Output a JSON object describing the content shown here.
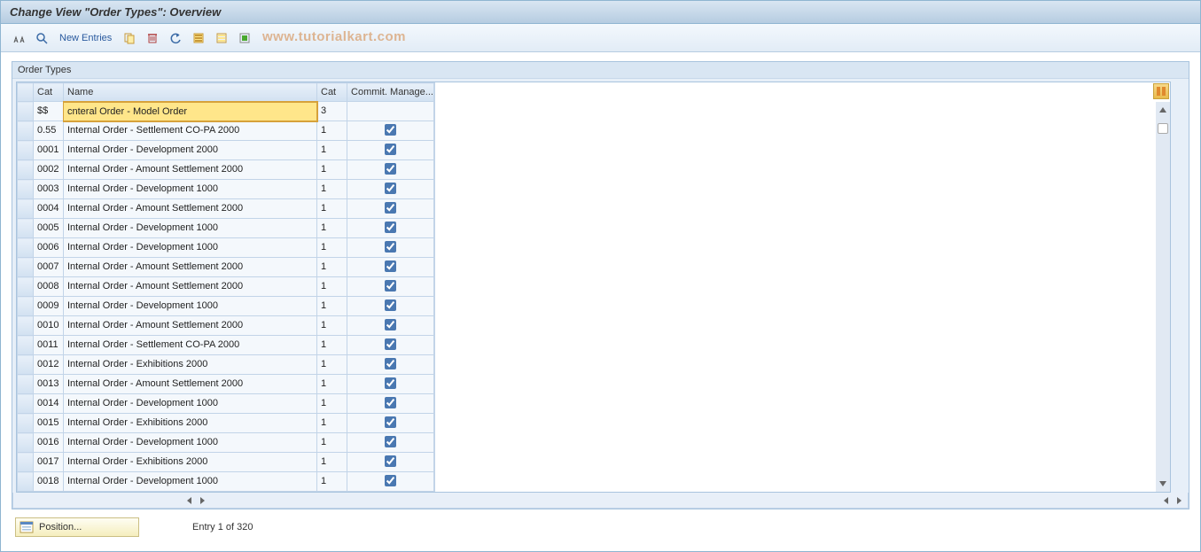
{
  "title": "Change View \"Order Types\": Overview",
  "watermark": "www.tutorialkart.com",
  "toolbar": {
    "new_entries_label": "New Entries"
  },
  "panel": {
    "title": "Order Types"
  },
  "columns": {
    "cat1": "Cat",
    "name": "Name",
    "cat2": "Cat",
    "commit": "Commit. Manage..."
  },
  "rows": [
    {
      "cat1": "$$",
      "name": "cnteral Order - Model Order",
      "cat2": "3",
      "commit": false,
      "selected": true
    },
    {
      "cat1": "0.55",
      "name": "Internal Order - Settlement CO-PA   2000",
      "cat2": "1",
      "commit": true
    },
    {
      "cat1": "0001",
      "name": "Internal Order - Development        2000",
      "cat2": "1",
      "commit": true
    },
    {
      "cat1": "0002",
      "name": "Internal Order - Amount Settlement  2000",
      "cat2": "1",
      "commit": true
    },
    {
      "cat1": "0003",
      "name": "Internal Order - Development        1000",
      "cat2": "1",
      "commit": true
    },
    {
      "cat1": "0004",
      "name": "Internal Order - Amount Settlement  2000",
      "cat2": "1",
      "commit": true
    },
    {
      "cat1": "0005",
      "name": "Internal Order - Development        1000",
      "cat2": "1",
      "commit": true
    },
    {
      "cat1": "0006",
      "name": "Internal Order - Development        1000",
      "cat2": "1",
      "commit": true
    },
    {
      "cat1": "0007",
      "name": "Internal Order - Amount Settlement  2000",
      "cat2": "1",
      "commit": true
    },
    {
      "cat1": "0008",
      "name": "Internal Order - Amount Settlement  2000",
      "cat2": "1",
      "commit": true
    },
    {
      "cat1": "0009",
      "name": "Internal Order - Development        1000",
      "cat2": "1",
      "commit": true
    },
    {
      "cat1": "0010",
      "name": "Internal Order - Amount Settlement  2000",
      "cat2": "1",
      "commit": true
    },
    {
      "cat1": "0011",
      "name": "Internal Order - Settlement CO-PA   2000",
      "cat2": "1",
      "commit": true
    },
    {
      "cat1": "0012",
      "name": "Internal Order - Exhibitions        2000",
      "cat2": "1",
      "commit": true
    },
    {
      "cat1": "0013",
      "name": "Internal Order - Amount Settlement  2000",
      "cat2": "1",
      "commit": true
    },
    {
      "cat1": "0014",
      "name": "Internal Order - Development        1000",
      "cat2": "1",
      "commit": true
    },
    {
      "cat1": "0015",
      "name": "Internal Order - Exhibitions        2000",
      "cat2": "1",
      "commit": true
    },
    {
      "cat1": "0016",
      "name": "Internal Order - Development        1000",
      "cat2": "1",
      "commit": true
    },
    {
      "cat1": "0017",
      "name": "Internal Order - Exhibitions        2000",
      "cat2": "1",
      "commit": true
    },
    {
      "cat1": "0018",
      "name": "Internal Order - Development        1000",
      "cat2": "1",
      "commit": true
    }
  ],
  "footer": {
    "position_label": "Position...",
    "entry_text": "Entry 1 of 320"
  }
}
